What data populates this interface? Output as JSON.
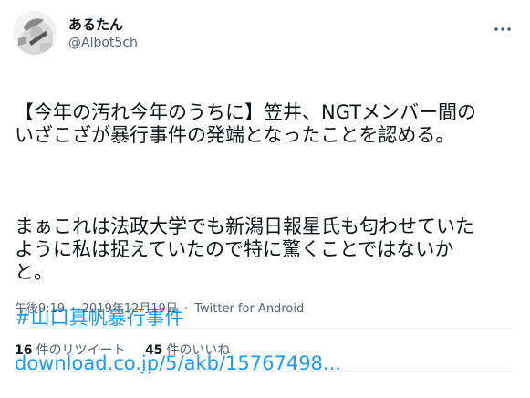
{
  "user": {
    "display_name": "あるたん",
    "handle": "@Albot5ch"
  },
  "tweet": {
    "paragraph1": "【今年の汚れ今年のうちに】笠井、NGTメンバー間の\nいざこざが暴行事件の発端となったことを認める。",
    "paragraph2": "まぁこれは法政大学でも新潟日報星氏も匂わせていた\nように私は捉えていたので特に驚くことではないか\nと。",
    "hashtag": "#山口真帆暴行事件",
    "url": "download.co.jp/5/akb/15767498..."
  },
  "meta": {
    "time": "午後9:19",
    "date": "2019年12月19日",
    "source": "Twitter for Android",
    "separator": "·"
  },
  "stats": {
    "retweets_count": "16",
    "retweets_label": "件のリツイート",
    "likes_count": "45",
    "likes_label": "件のいいね"
  },
  "colors": {
    "link": "#1d9bf0",
    "secondary_text": "#536471",
    "primary_text": "#0f1419"
  },
  "icons": {
    "more": "more-horizontal-icon",
    "avatar": "avatar-illustration"
  }
}
